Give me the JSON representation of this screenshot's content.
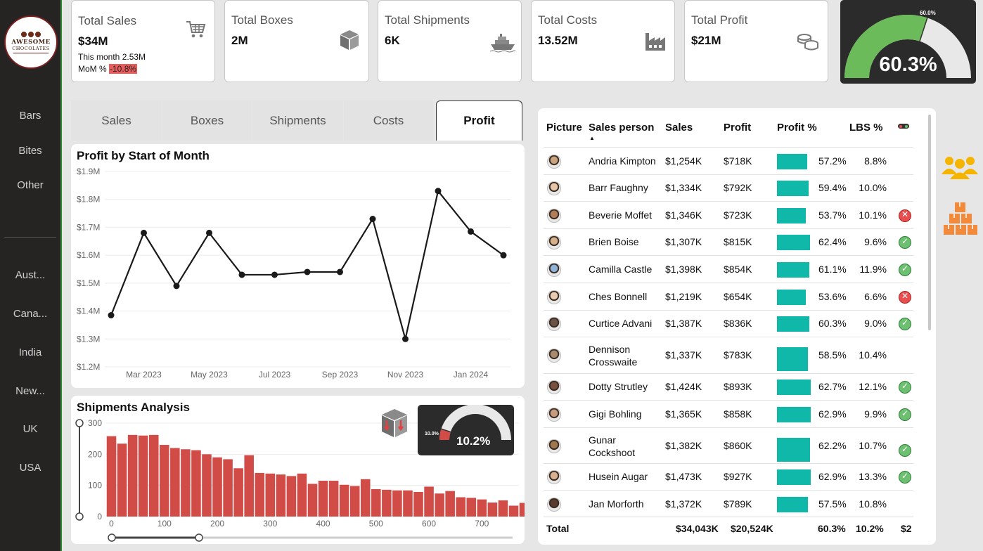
{
  "brand": {
    "line1": "AWESOME",
    "line2": "CHOCOLATES"
  },
  "sidebar": {
    "products": [
      {
        "label": "Bars"
      },
      {
        "label": "Bites"
      },
      {
        "label": "Other"
      }
    ],
    "countries": [
      {
        "label": "Aust..."
      },
      {
        "label": "Cana..."
      },
      {
        "label": "India"
      },
      {
        "label": "New..."
      },
      {
        "label": "UK"
      },
      {
        "label": "USA"
      }
    ]
  },
  "kpis": {
    "sales": {
      "label": "Total Sales",
      "value": "$34M",
      "this_month": "This month 2.53M",
      "mom_label": "MoM % ",
      "mom_value": "-10.8%",
      "icon": "shopping-cart-icon"
    },
    "boxes": {
      "label": "Total Boxes",
      "value": "2M",
      "icon": "box-icon"
    },
    "shipments": {
      "label": "Total Shipments",
      "value": "6K",
      "icon": "ship-icon"
    },
    "costs": {
      "label": "Total Costs",
      "value": "13.52M",
      "icon": "factory-icon"
    },
    "profit": {
      "label": "Total Profit",
      "value": "$21M",
      "icon": "coins-icon"
    }
  },
  "profit_gauge": {
    "value": "60.3%",
    "target": "60.0%",
    "fraction": 0.603,
    "color": "#6cbb5a"
  },
  "tabs": [
    {
      "label": "Sales"
    },
    {
      "label": "Boxes"
    },
    {
      "label": "Shipments"
    },
    {
      "label": "Costs"
    },
    {
      "label": "Profit"
    }
  ],
  "active_tab": "Profit",
  "profit_chart": {
    "title": "Profit by Start of Month",
    "y_ticks": [
      "$1.9M",
      "$1.8M",
      "$1.7M",
      "$1.6M",
      "$1.5M",
      "$1.4M",
      "$1.3M",
      "$1.2M"
    ],
    "x_ticks": [
      "Mar 2023",
      "May 2023",
      "Jul 2023",
      "Sep 2023",
      "Nov 2023",
      "Jan 2024"
    ]
  },
  "shipments_chart": {
    "title": "Shipments Analysis",
    "y_ticks": [
      "300",
      "200",
      "100",
      "0"
    ],
    "x_ticks": [
      "0",
      "100",
      "200",
      "300",
      "400",
      "500",
      "600",
      "700"
    ],
    "gauge_value": "10.2%",
    "gauge_target": "10.0%",
    "gauge_fraction": 0.102,
    "bar_color": "#d14b47"
  },
  "chart_data": [
    {
      "type": "line",
      "title": "Profit by Start of Month",
      "x": [
        "Feb 2023",
        "Mar 2023",
        "Apr 2023",
        "May 2023",
        "Jun 2023",
        "Jul 2023",
        "Aug 2023",
        "Sep 2023",
        "Oct 2023",
        "Nov 2023",
        "Dec 2023",
        "Jan 2024",
        "Feb 2024"
      ],
      "series": [
        {
          "values": [
            1.385,
            1.68,
            1.49,
            1.68,
            1.53,
            1.53,
            1.54,
            1.54,
            1.73,
            1.3,
            1.83,
            1.685,
            1.6
          ]
        }
      ],
      "ylim": [
        1.2,
        1.9
      ],
      "unit": "$M",
      "grid": true
    },
    {
      "type": "bar",
      "title": "Shipments Analysis",
      "x_start": 0,
      "x_step": 20,
      "values": [
        258,
        234,
        262,
        260,
        262,
        230,
        220,
        216,
        213,
        200,
        190,
        184,
        155,
        197,
        140,
        138,
        135,
        130,
        138,
        105,
        115,
        115,
        102,
        98,
        120,
        88,
        86,
        84,
        84,
        79,
        96,
        74,
        82,
        62,
        60,
        55,
        45,
        52,
        35,
        44,
        35
      ],
      "ylim": [
        0,
        300
      ],
      "xlim": [
        -10,
        770
      ],
      "grid": true
    }
  ],
  "table": {
    "headers": {
      "picture": "Picture",
      "sales_person": "Sales person",
      "sales": "Sales",
      "profit": "Profit",
      "profit_pct": "Profit %",
      "lbs_pct": "LBS %"
    },
    "rows": [
      {
        "name": "Andria Kimpton",
        "sales": "$1,254K",
        "profit": "$718K",
        "profit_pct": "57.2%",
        "pct": 0.572,
        "lbs": "8.8%",
        "status": "none"
      },
      {
        "name": "Barr Faughny",
        "sales": "$1,334K",
        "profit": "$792K",
        "profit_pct": "59.4%",
        "pct": 0.594,
        "lbs": "10.0%",
        "status": "none"
      },
      {
        "name": "Beverie Moffet",
        "sales": "$1,346K",
        "profit": "$723K",
        "profit_pct": "53.7%",
        "pct": 0.537,
        "lbs": "10.1%",
        "status": "bad"
      },
      {
        "name": "Brien Boise",
        "sales": "$1,307K",
        "profit": "$815K",
        "profit_pct": "62.4%",
        "pct": 0.624,
        "lbs": "9.6%",
        "status": "ok"
      },
      {
        "name": "Camilla Castle",
        "sales": "$1,398K",
        "profit": "$854K",
        "profit_pct": "61.1%",
        "pct": 0.611,
        "lbs": "11.9%",
        "status": "ok"
      },
      {
        "name": "Ches Bonnell",
        "sales": "$1,219K",
        "profit": "$654K",
        "profit_pct": "53.6%",
        "pct": 0.536,
        "lbs": "6.6%",
        "status": "bad"
      },
      {
        "name": "Curtice Advani",
        "sales": "$1,387K",
        "profit": "$836K",
        "profit_pct": "60.3%",
        "pct": 0.603,
        "lbs": "9.0%",
        "status": "ok"
      },
      {
        "name": "Dennison Crosswaite",
        "name1": "Dennison",
        "name2": "Crosswaite",
        "sales": "$1,337K",
        "profit": "$783K",
        "profit_pct": "58.5%",
        "pct": 0.585,
        "lbs": "10.4%",
        "status": "none"
      },
      {
        "name": "Dotty Strutley",
        "sales": "$1,424K",
        "profit": "$893K",
        "profit_pct": "62.7%",
        "pct": 0.627,
        "lbs": "12.1%",
        "status": "ok"
      },
      {
        "name": "Gigi Bohling",
        "sales": "$1,365K",
        "profit": "$858K",
        "profit_pct": "62.9%",
        "pct": 0.629,
        "lbs": "9.9%",
        "status": "ok"
      },
      {
        "name": "Gunar Cockshoot",
        "name1": "Gunar",
        "name2": "Cockshoot",
        "sales": "$1,382K",
        "profit": "$860K",
        "profit_pct": "62.2%",
        "pct": 0.622,
        "lbs": "10.7%",
        "status": "ok"
      },
      {
        "name": "Husein Augar",
        "sales": "$1,473K",
        "profit": "$927K",
        "profit_pct": "62.9%",
        "pct": 0.629,
        "lbs": "13.3%",
        "status": "ok"
      },
      {
        "name": "Jan Morforth",
        "sales": "$1,372K",
        "profit": "$789K",
        "profit_pct": "57.5%",
        "pct": 0.575,
        "lbs": "10.8%",
        "status": "none"
      }
    ],
    "totals": {
      "label": "Total",
      "sales": "$34,043K",
      "profit": "$20,524K",
      "profit_pct": "60.3%",
      "lbs": "10.2%",
      "extra": "$2"
    },
    "accent_color": "#0fb8a8"
  }
}
